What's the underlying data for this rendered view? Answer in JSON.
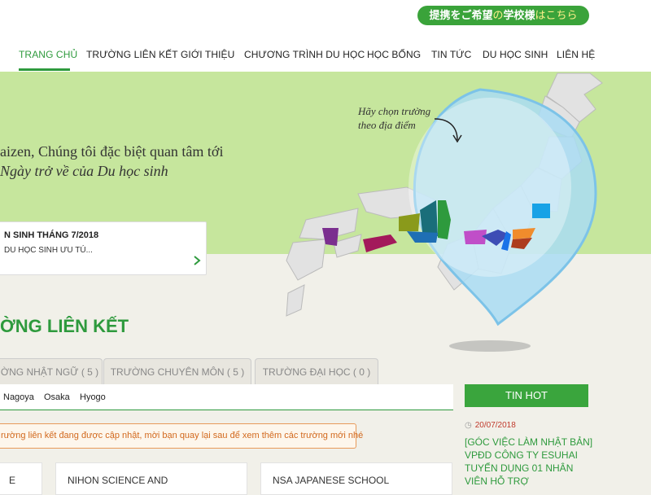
{
  "header": {
    "partner_button": {
      "part1": "提携をご希望",
      "part2": "の",
      "part3": "学校様",
      "part4": "はこちら"
    },
    "nav": [
      {
        "label": "TRANG CHỦ",
        "active": true
      },
      {
        "label": "TRƯỜNG LIÊN KẾT"
      },
      {
        "label": "GIỚI THIỆU"
      },
      {
        "label": "CHƯƠNG TRÌNH DU HỌC"
      },
      {
        "label": "HỌC BỔNG"
      },
      {
        "label": "TIN TỨC"
      },
      {
        "label": "DU HỌC SINH"
      },
      {
        "label": "LIÊN HỆ"
      }
    ]
  },
  "hero": {
    "line1": "aizen, Chúng tôi đặc biệt quan tâm tới",
    "line2": "Ngày trở về của Du học sinh",
    "map_hint_line1": "Hãy chọn trường",
    "map_hint_line2": "theo địa điểm",
    "news": {
      "title": "N SINH THÁNG 7/2018",
      "subtitle": "DU HỌC SINH ƯU TÚ..."
    }
  },
  "schools": {
    "section_title": "ỜNG LIÊN KẾT",
    "tabs": [
      "ỜNG NHẬT NGỮ ( 5 )",
      "TRƯỜNG CHUYÊN MÔN ( 5 )",
      "TRƯỜNG ĐẠI HỌC ( 0 )"
    ],
    "filters": [
      "Nagoya",
      "Osaka",
      "Hyogo"
    ],
    "notice": "rường liên kết đang được cập nhật, mời bạn quay lại sau để xem thêm các trường mới nhé",
    "cards": [
      "E",
      "NIHON SCIENCE AND",
      "NSA JAPANESE SCHOOL"
    ]
  },
  "sidebar": {
    "tin_hot_label": "TIN HOT",
    "hot_news": {
      "date": "20/07/2018",
      "title": "[GÓC VIỆC LÀM NHẬT BẢN] VPĐD CÔNG TY ESUHAI TUYỂN DỤNG 01 NHÂN VIÊN HỖ TRỢ"
    }
  },
  "colors": {
    "brand_green": "#2e9a3d",
    "hero_green": "#c6e69d",
    "notice_orange": "#d2691e",
    "hot_date_red": "#c0392b"
  }
}
